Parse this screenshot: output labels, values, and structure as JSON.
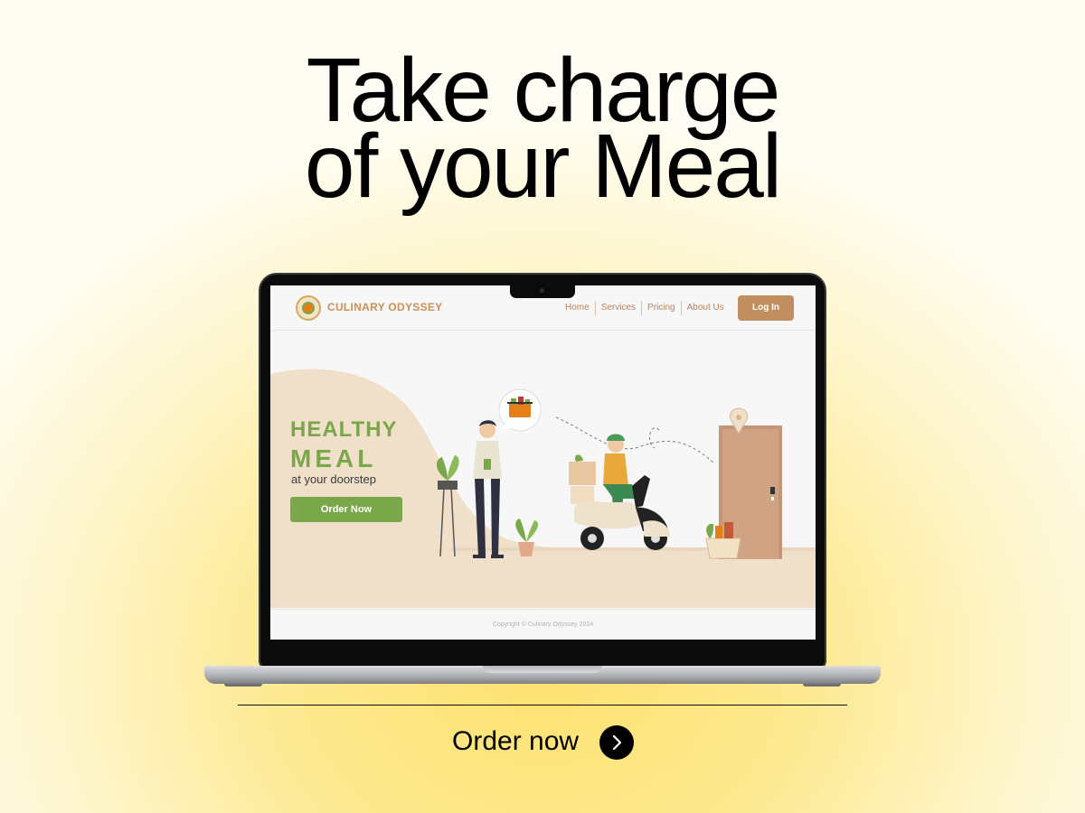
{
  "headline": {
    "line1": "Take charge",
    "line2": "of your Meal"
  },
  "website": {
    "brand": "CULINARY ODYSSEY",
    "nav": {
      "home": "Home",
      "services": "Services",
      "pricing": "Pricing",
      "about": "About Us"
    },
    "login": "Log In",
    "hero": {
      "title1": "HEALTHY",
      "title2": "MEAL",
      "subtitle": "at your doorstep",
      "button": "Order Now"
    },
    "footer": "Copyright © Culinary Odyssey 2024"
  },
  "cta": {
    "label": "Order now",
    "icon": "chevron-right-icon"
  },
  "colors": {
    "accent_green": "#7aa74a",
    "accent_brown": "#c08e5f",
    "hero_bg": "#f0e0c9",
    "cta": "#000000"
  }
}
